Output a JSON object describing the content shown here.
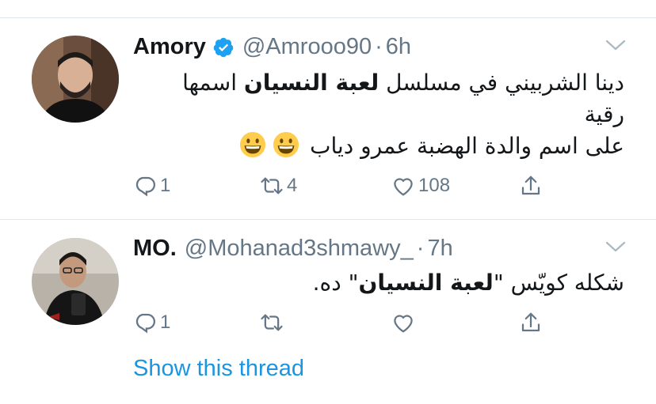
{
  "tweets": [
    {
      "name": "Amory",
      "handle": "@Amrooo90",
      "dot": "·",
      "time": "6h",
      "text_lines": [
        [
          "دينا الشربيني في مسلسل ",
          "لعبة النسيان",
          " اسمها"
        ],
        [
          "رقية"
        ],
        [
          "على اسم والدة الهضبة عمرو دياب "
        ]
      ],
      "replies": "1",
      "retweets": "4",
      "likes": "108",
      "verified": true
    },
    {
      "name": "MO.",
      "handle": "@Mohanad3shmawy_",
      "dot": "·",
      "time": "7h",
      "text_lines": [
        [
          "شكله كويّس \"",
          "لعبة النسيان",
          "\" ده."
        ]
      ],
      "replies": "1",
      "retweets": "",
      "likes": "",
      "verified": false,
      "thread_link": "Show this thread"
    }
  ],
  "colors": {
    "text": "#14171a",
    "secondary": "#657786",
    "link": "#1b95e0",
    "divider": "#e1e8ed",
    "verified": "#1da1f2"
  },
  "icons": [
    "verified-badge-icon",
    "chevron-down-icon",
    "reply-icon",
    "retweet-icon",
    "like-icon",
    "share-icon",
    "grinning-emoji-icon"
  ]
}
